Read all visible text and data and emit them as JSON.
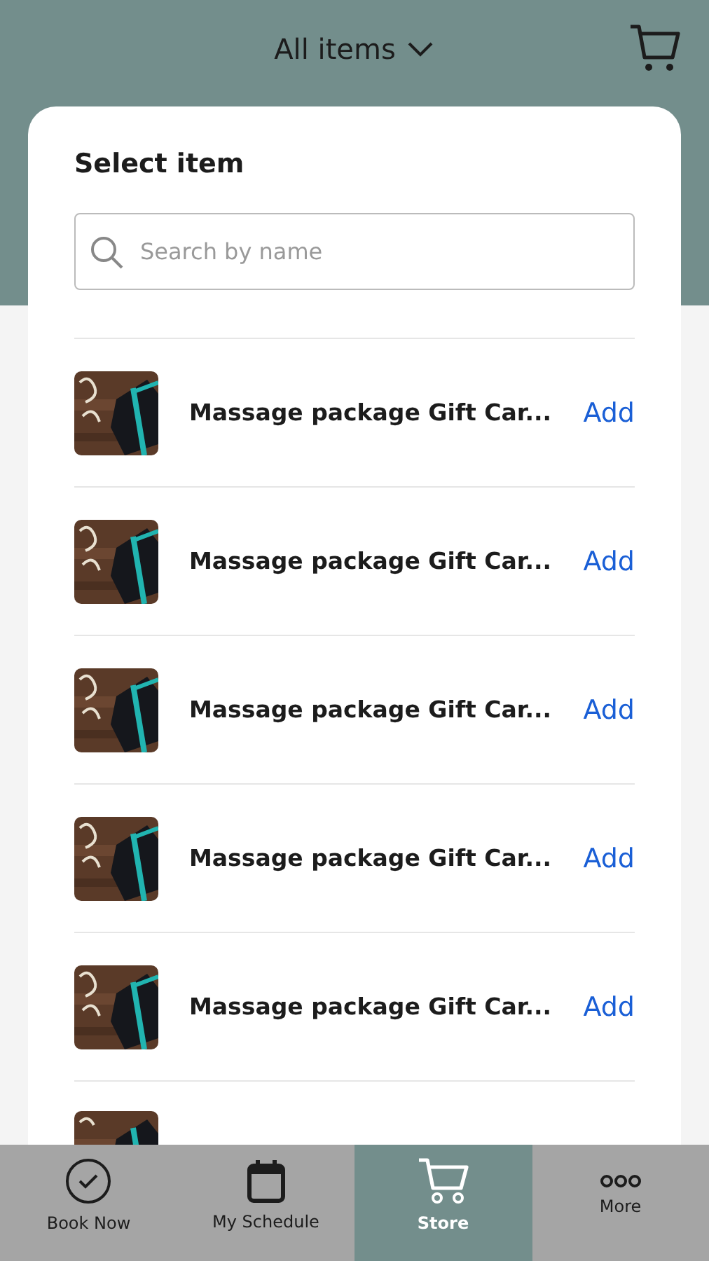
{
  "header": {
    "title": "All items"
  },
  "panel": {
    "title": "Select item",
    "search": {
      "placeholder": "Search by name"
    }
  },
  "items": [
    {
      "name": "Massage package Gift Car...",
      "action": "Add"
    },
    {
      "name": "Massage package Gift Car...",
      "action": "Add"
    },
    {
      "name": "Massage package Gift Car...",
      "action": "Add"
    },
    {
      "name": "Massage package Gift Car...",
      "action": "Add"
    },
    {
      "name": "Massage package Gift Car...",
      "action": "Add"
    }
  ],
  "more_below": true,
  "nav": [
    {
      "label": "Book Now",
      "kind": "check",
      "selected": false
    },
    {
      "label": "My Schedule",
      "kind": "calendar",
      "selected": false
    },
    {
      "label": "Store",
      "kind": "cart",
      "selected": true
    },
    {
      "label": "More",
      "kind": "dots",
      "selected": false
    }
  ]
}
